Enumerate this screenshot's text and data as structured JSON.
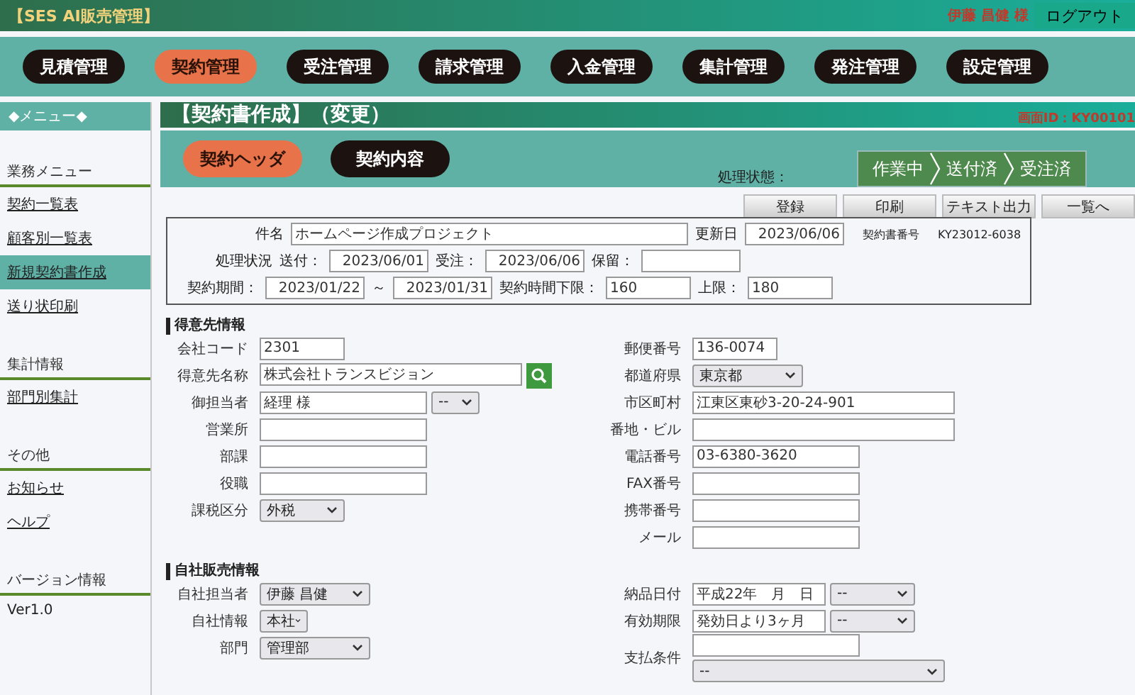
{
  "app_title": "【SES AI販売管理】",
  "user": "伊藤 昌健 様",
  "logout": "ログアウト",
  "nav": [
    {
      "label": "見積管理",
      "selected": false
    },
    {
      "label": "契約管理",
      "selected": true
    },
    {
      "label": "受注管理",
      "selected": false
    },
    {
      "label": "請求管理",
      "selected": false
    },
    {
      "label": "入金管理",
      "selected": false
    },
    {
      "label": "集計管理",
      "selected": false
    },
    {
      "label": "発注管理",
      "selected": false
    },
    {
      "label": "設定管理",
      "selected": false
    }
  ],
  "sidebar": {
    "header": "◆メニュー◆",
    "sections": [
      {
        "title": "業務メニュー",
        "items": [
          {
            "label": "契約一覧表",
            "kind": "link",
            "selected": false
          },
          {
            "label": "顧客別一覧表",
            "kind": "link",
            "selected": false
          },
          {
            "label": "新規契約書作成",
            "kind": "link",
            "selected": true
          },
          {
            "label": "送り状印刷",
            "kind": "link",
            "selected": false
          }
        ]
      },
      {
        "title": "集計情報",
        "items": [
          {
            "label": "部門別集計",
            "kind": "link",
            "selected": false
          }
        ]
      },
      {
        "title": "その他",
        "items": [
          {
            "label": "お知らせ",
            "kind": "link",
            "selected": false
          },
          {
            "label": "ヘルプ",
            "kind": "link",
            "selected": false
          }
        ]
      },
      {
        "title": "バージョン情報",
        "items": [
          {
            "label": "Ver1.0",
            "kind": "text",
            "selected": false
          }
        ]
      }
    ]
  },
  "page_title": "【契約書作成】（変更）",
  "screen_id": "画面ID：KY00101",
  "tabs": [
    {
      "label": "契約ヘッダ",
      "selected": true
    },
    {
      "label": "契約内容",
      "selected": false
    }
  ],
  "status_label": "処理状態：",
  "steps": [
    "作業中",
    "送付済",
    "受注済"
  ],
  "actions": [
    "登録",
    "印刷",
    "テキスト出力",
    "一覧へ"
  ],
  "header_rows": [
    [
      {
        "kind": "label",
        "text": "件名"
      },
      {
        "kind": "wide-input",
        "value": "ホームページ作成プロジェクト"
      },
      {
        "kind": "label",
        "text": "更新日"
      },
      {
        "kind": "date-input",
        "value": "2023/06/06"
      },
      {
        "kind": "note",
        "text": "契約書番号"
      },
      {
        "kind": "note",
        "text": "KY23012-6038"
      }
    ],
    [
      {
        "kind": "label",
        "text": "処理状況"
      },
      {
        "kind": "label",
        "text": "送付："
      },
      {
        "kind": "date-input",
        "value": "2023/06/01"
      },
      {
        "kind": "label",
        "text": "受注："
      },
      {
        "kind": "date-input",
        "value": "2023/06/06"
      },
      {
        "kind": "label",
        "text": "保留："
      },
      {
        "kind": "date-input"
      }
    ],
    [
      {
        "kind": "label",
        "text": "契約期間："
      },
      {
        "kind": "date-input",
        "value": "2023/01/22"
      },
      {
        "kind": "label",
        "text": "～"
      },
      {
        "kind": "date-input",
        "value": "2023/01/31"
      },
      {
        "kind": "label",
        "text": "契約時間下限："
      },
      {
        "kind": "input",
        "value": "160"
      },
      {
        "kind": "label",
        "text": "上限："
      },
      {
        "kind": "input",
        "value": "180"
      }
    ]
  ],
  "sections": [
    {
      "title": "得意先情報",
      "left": [
        {
          "label": "会社コード",
          "controls": [
            {
              "kind": "short-text",
              "value": "2301"
            }
          ]
        },
        {
          "label": "得意先名称",
          "controls": [
            {
              "kind": "long-text",
              "value": "株式会社トランスビジョン"
            },
            {
              "kind": "search-button"
            }
          ]
        },
        {
          "label": "御担当者",
          "controls": [
            {
              "kind": "text",
              "value": "経理 様"
            },
            {
              "kind": "short-select",
              "value": "--"
            }
          ]
        },
        {
          "label": "営業所",
          "controls": [
            {
              "kind": "text"
            }
          ]
        },
        {
          "label": "部課",
          "controls": [
            {
              "kind": "text"
            }
          ]
        },
        {
          "label": "役職",
          "controls": [
            {
              "kind": "text"
            }
          ]
        },
        {
          "label": "課税区分",
          "controls": [
            {
              "kind": "select",
              "value": "外税"
            }
          ]
        }
      ],
      "right": [
        {
          "label": "郵便番号",
          "controls": [
            {
              "kind": "short-text",
              "value": "136-0074"
            }
          ]
        },
        {
          "label": "都道府県",
          "controls": [
            {
              "kind": "select",
              "value": "東京都"
            }
          ]
        },
        {
          "label": "市区町村",
          "controls": [
            {
              "kind": "long-text",
              "value": "江東区東砂3-20-24-901"
            }
          ]
        },
        {
          "label": "番地・ビル",
          "controls": [
            {
              "kind": "long-text"
            }
          ]
        },
        {
          "label": "電話番号",
          "controls": [
            {
              "kind": "text",
              "value": "03-6380-3620"
            }
          ]
        },
        {
          "label": "FAX番号",
          "controls": [
            {
              "kind": "text"
            }
          ]
        },
        {
          "label": "携帯番号",
          "controls": [
            {
              "kind": "text"
            }
          ]
        },
        {
          "label": "メール",
          "controls": [
            {
              "kind": "text"
            }
          ]
        }
      ]
    },
    {
      "title": "自社販売情報",
      "left": [
        {
          "label": "自社担当者",
          "controls": [
            {
              "kind": "select",
              "value": "伊藤 昌健"
            }
          ]
        },
        {
          "label": "自社情報",
          "controls": [
            {
              "kind": "short-select",
              "value": "本社"
            }
          ]
        },
        {
          "label": "部門",
          "controls": [
            {
              "kind": "select",
              "value": "管理部"
            }
          ]
        }
      ],
      "right": [
        {
          "label": "納品日付",
          "controls": [
            {
              "kind": "date-text",
              "value": "平成22年　月　日"
            },
            {
              "kind": "select",
              "value": "--"
            }
          ]
        },
        {
          "label": "有効期限",
          "controls": [
            {
              "kind": "date-text",
              "value": "発効日より3ヶ月"
            },
            {
              "kind": "select",
              "value": "--"
            }
          ]
        },
        {
          "label": "支払条件",
          "stacked": true,
          "controls": [
            {
              "kind": "text"
            },
            {
              "kind": "long-select",
              "value": "--"
            }
          ]
        }
      ]
    }
  ]
}
